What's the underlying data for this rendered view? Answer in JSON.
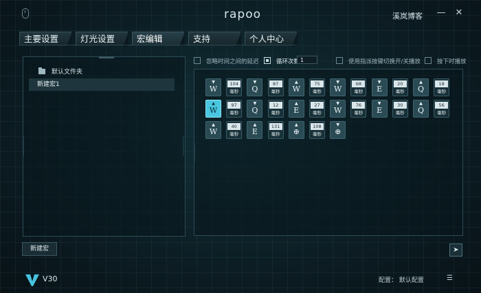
{
  "titlebar": {
    "logo": "rapoo",
    "user": "溪岚博客",
    "minimize": "—",
    "close": "✕"
  },
  "tabs": [
    "主要设置",
    "灯光设置",
    "宏编辑",
    "支持",
    "个人中心"
  ],
  "active_tab": 2,
  "left_panel": {
    "folder": "默认文件夹",
    "macro_item": "新建宏1",
    "new_button": "新建宏"
  },
  "options": {
    "ignore_delay": "忽略时间之间的延迟",
    "loop": "循环次数",
    "loop_count": "1",
    "toggle": "使用指派按键切换开/关播放",
    "hold": "按下时播放"
  },
  "macro_rows": [
    [
      {
        "t": "key",
        "dir": "▼",
        "key": "W"
      },
      {
        "t": "delay",
        "v": "104",
        "u": "毫秒"
      },
      {
        "t": "key",
        "dir": "▼",
        "key": "Q"
      },
      {
        "t": "delay",
        "v": "87",
        "u": "毫秒"
      },
      {
        "t": "key",
        "dir": "▲",
        "key": "W"
      },
      {
        "t": "delay",
        "v": "75",
        "u": "毫秒"
      },
      {
        "t": "key",
        "dir": "▼",
        "key": "W"
      },
      {
        "t": "delay",
        "v": "68",
        "u": "毫秒"
      },
      {
        "t": "key",
        "dir": "▼",
        "key": "E"
      },
      {
        "t": "delay",
        "v": "20",
        "u": "毫秒"
      },
      {
        "t": "key",
        "dir": "▲",
        "key": "Q"
      },
      {
        "t": "delay",
        "v": "18",
        "u": "毫秒"
      }
    ],
    [
      {
        "t": "key",
        "dir": "▲",
        "key": "W",
        "active": true
      },
      {
        "t": "delay",
        "v": "97",
        "u": "毫秒"
      },
      {
        "t": "key",
        "dir": "▼",
        "key": "Q"
      },
      {
        "t": "delay",
        "v": "12",
        "u": "毫秒"
      },
      {
        "t": "key",
        "dir": "▲",
        "key": "E"
      },
      {
        "t": "delay",
        "v": "27",
        "u": "毫秒"
      },
      {
        "t": "key",
        "dir": "▼",
        "key": "W"
      },
      {
        "t": "delay",
        "v": "76",
        "u": "毫秒"
      },
      {
        "t": "key",
        "dir": "▼",
        "key": "E"
      },
      {
        "t": "delay",
        "v": "30",
        "u": "毫秒"
      },
      {
        "t": "key",
        "dir": "▲",
        "key": "Q"
      },
      {
        "t": "delay",
        "v": "56",
        "u": "毫秒"
      }
    ],
    [
      {
        "t": "key",
        "dir": "▲",
        "key": "W"
      },
      {
        "t": "delay",
        "v": "40",
        "u": "毫秒"
      },
      {
        "t": "key",
        "dir": "▲",
        "key": "E"
      },
      {
        "t": "delay",
        "v": "131",
        "u": "毫秒"
      },
      {
        "t": "key",
        "dir": "▲",
        "key": "⊕"
      },
      {
        "t": "delay",
        "v": "108",
        "u": "毫秒"
      },
      {
        "t": "key",
        "dir": "▼",
        "key": "⊕"
      }
    ]
  ],
  "footer": {
    "brand": "V30",
    "config": "配置：  默认配置",
    "menu": "☰",
    "send": "➤"
  }
}
